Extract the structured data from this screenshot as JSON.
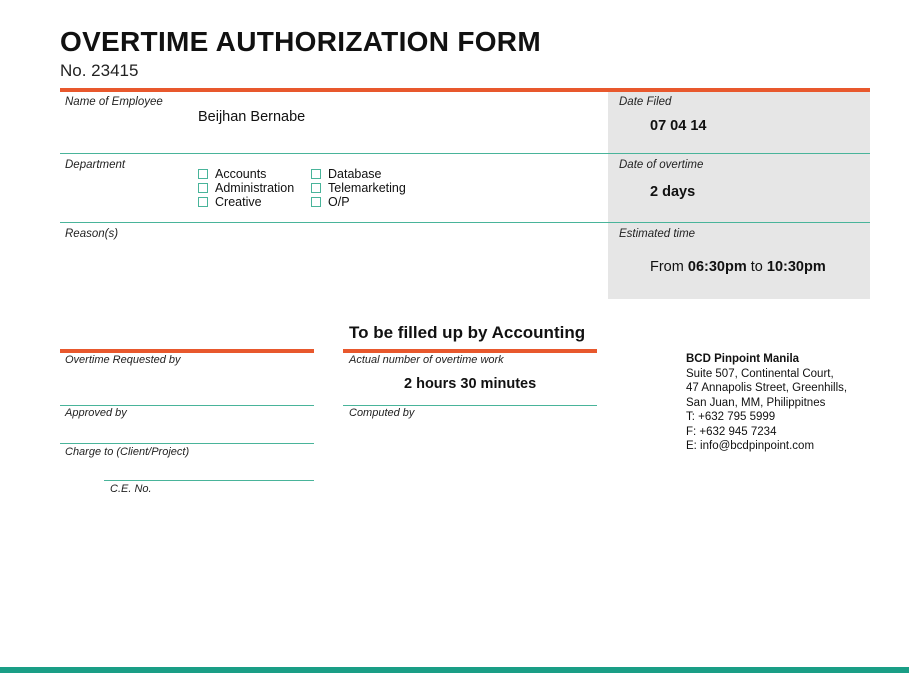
{
  "form": {
    "title": "OVERTIME AUTHORIZATION FORM",
    "number": "No. 23415"
  },
  "employee": {
    "label": "Name of Employee",
    "value": "Beijhan Bernabe"
  },
  "date_filed": {
    "label": "Date Filed",
    "value": "07 04 14"
  },
  "department": {
    "label": "Department",
    "options": [
      "Accounts",
      "Administration",
      "Creative",
      "Database",
      "Telemarketing",
      "O/P"
    ]
  },
  "date_of_overtime": {
    "label": "Date of overtime",
    "value": "2 days"
  },
  "reasons": {
    "label": "Reason(s)"
  },
  "estimated_time": {
    "label": "Estimated time",
    "from_word": "From",
    "from_time": "06:30pm",
    "to_word": "to",
    "to_time": "10:30pm"
  },
  "left_section": {
    "requested_by": "Overtime Requested by",
    "approved_by": "Approved by",
    "charge_to": "Charge to (Client/Project)",
    "ce_no": "C.E. No."
  },
  "accounting": {
    "title": "To be filled up by Accounting",
    "actual_label": "Actual number of overtime work",
    "actual_value": "2 hours 30 minutes",
    "computed_by": "Computed by"
  },
  "company": {
    "name": "BCD Pinpoint Manila",
    "address1": "Suite 507, Continental Court,",
    "address2": "47 Annapolis Street, Greenhills,",
    "address3": "San Juan, MM, Philippitnes",
    "phone": "T: +632 795 5999",
    "fax": "F: +632 945 7234",
    "email": "E: info@bcdpinpoint.com"
  },
  "colors": {
    "accent_orange": "#e8582d",
    "accent_teal": "#1a9e86",
    "line_teal": "#49b49a",
    "panel_gray": "#e6e6e6"
  }
}
